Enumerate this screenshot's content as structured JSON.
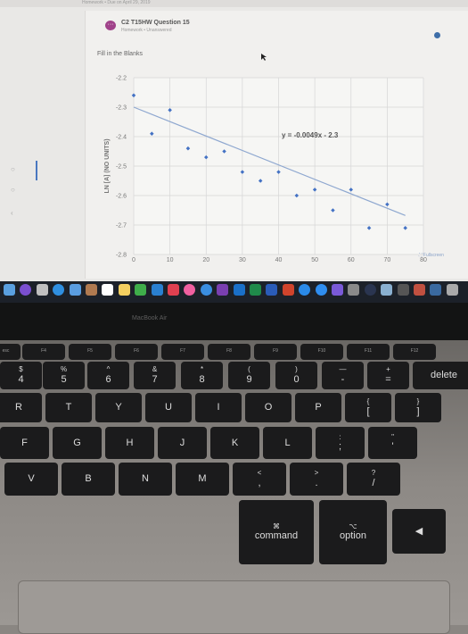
{
  "header": {
    "breadcrumb": "Homework • Due on April 29, 2019"
  },
  "question": {
    "title": "C2 T15HW Question 15",
    "subtitle": "Homework • Unanswered",
    "instruction": "Fill in the Blanks",
    "fullscreen_label": "Fullscreen"
  },
  "chart_data": {
    "type": "scatter",
    "title": "",
    "xlabel": "",
    "ylabel": "LN [A] (NO UNITS)",
    "xlim": [
      0,
      80
    ],
    "ylim": [
      -2.8,
      -2.2
    ],
    "x_ticks": [
      "0",
      "10",
      "20",
      "30",
      "40",
      "50",
      "60",
      "70",
      "80"
    ],
    "y_ticks": [
      "-2.2",
      "-2.3",
      "-2.4",
      "-2.5",
      "-2.6",
      "-2.7",
      "-2.8"
    ],
    "grid": true,
    "x": [
      0,
      5,
      10,
      15,
      20,
      25,
      30,
      35,
      40,
      45,
      50,
      55,
      60,
      65,
      70,
      75
    ],
    "y": [
      -2.26,
      -2.39,
      -2.31,
      -2.44,
      -2.47,
      -2.45,
      -2.52,
      -2.55,
      -2.52,
      -2.6,
      -2.58,
      -2.65,
      -2.58,
      -2.71,
      -2.63,
      -2.71
    ],
    "trendline": {
      "slope": -0.0049,
      "intercept": -2.3,
      "label": "y = -0.0049x - 2.3"
    },
    "colors": {
      "points": "#4472c4",
      "trendline": "#8fa8d0"
    }
  },
  "dock": {
    "icons": [
      "finder-icon",
      "siri-icon",
      "launchpad-icon",
      "safari-icon",
      "mail-icon",
      "contacts-icon",
      "calendar-icon",
      "notes-icon",
      "numbers-icon",
      "keynote-icon",
      "news-icon",
      "itunes-icon",
      "onedrive-icon",
      "onenote-icon",
      "outlook-icon",
      "excel-icon",
      "word-icon",
      "powerpoint-icon",
      "safari-compass-icon",
      "app-store-icon",
      "imovie-icon",
      "system-preferences-icon",
      "quicktime-icon",
      "preview-icon",
      "window-icon",
      "window-icon",
      "window-icon",
      "trash-icon"
    ]
  },
  "laptop": {
    "model": "MacBook Air"
  },
  "keyboard": {
    "fn": [
      "esc",
      "F4",
      "F5",
      "F6",
      "F7",
      "F8",
      "F9",
      "F10",
      "F11",
      "F12"
    ],
    "num": [
      [
        "$",
        "4"
      ],
      [
        "%",
        "5"
      ],
      [
        "^",
        "6"
      ],
      [
        "&",
        "7"
      ],
      [
        "*",
        "8"
      ],
      [
        "(",
        "9"
      ],
      [
        ")",
        "0"
      ],
      [
        "—",
        "-"
      ],
      [
        "+",
        "="
      ],
      [
        "",
        "delete"
      ]
    ],
    "row1": [
      "R",
      "T",
      "Y",
      "U",
      "I",
      "O",
      "P",
      [
        "{",
        "["
      ],
      [
        "}",
        "]"
      ]
    ],
    "row2": [
      "F",
      "G",
      "H",
      "J",
      "K",
      "L",
      [
        ":",
        ";"
      ],
      [
        "\"",
        "'"
      ]
    ],
    "row3": [
      "V",
      "B",
      "N",
      "M",
      [
        "<",
        ","
      ],
      [
        ">",
        "."
      ],
      [
        "?",
        "/"
      ]
    ],
    "command": {
      "symbol": "⌘",
      "label": "command"
    },
    "option": {
      "symbol": "⌥",
      "label": "option"
    },
    "arrow": "◀"
  }
}
